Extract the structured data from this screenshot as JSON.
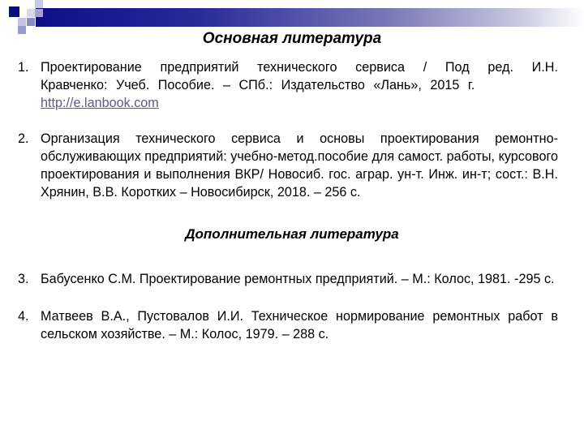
{
  "slide": {
    "main_heading": "Основная литература",
    "additional_heading": "Дополнительная литература",
    "main_items": [
      {
        "number": "1.",
        "text": "Проектирование предприятий технического сервиса / Под ред. И.Н. Кравченко: Учеб. Пособие. – СПб.: Издательство «Лань», 2015 г.",
        "link": "http://e.lanbook.com"
      },
      {
        "number": "2.",
        "text": "Организация технического сервиса и основы проектирования ремонтно-обслуживающих предприятий: учебно-метод.пособие для самост. работы, курсового проектирования и выполнения ВКР/ Новосиб. гос. аграр. ун-т. Инж. ин-т; сост.: В.Н. Хрянин, В.В. Коротких – Новосибирск, 2018. – 256 с."
      }
    ],
    "additional_items": [
      {
        "number": "3.",
        "text": "Бабусенко С.М. Проектирование ремонтных предприятий. – М.: Колос, 1981. -295 с."
      },
      {
        "number": "4.",
        "text": "Матвеев В.А., Пустовалов И.И. Техническое нормирование ремонтных работ в сельском хозяйстве. – М.: Колос, 1979. – 288 с."
      }
    ],
    "colors": {
      "accent_dark": "#0c0c7a",
      "link": "#5a5a8e"
    }
  }
}
